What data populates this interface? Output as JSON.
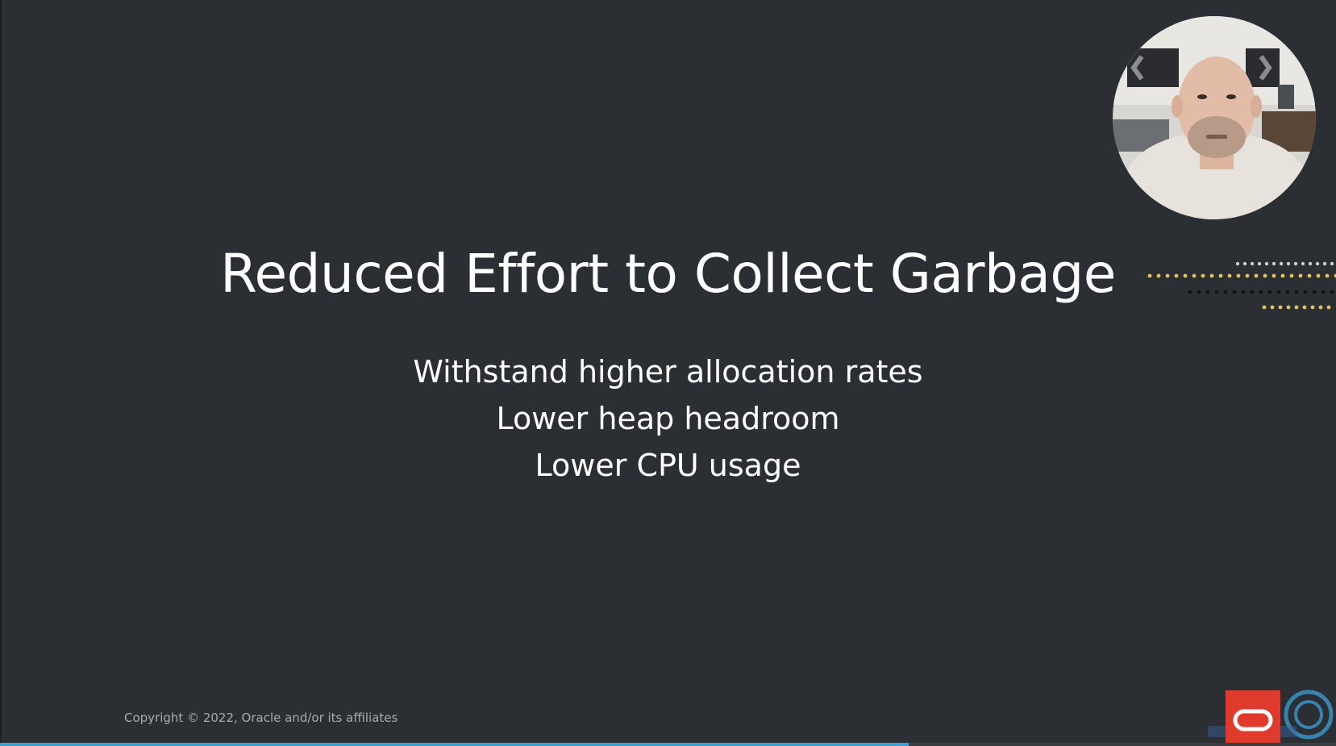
{
  "slide": {
    "title": "Reduced Effort to Collect Garbage",
    "bullets": [
      "Withstand higher allocation rates",
      "Lower heap headroom",
      "Lower CPU usage"
    ],
    "copyright": "Copyright © 2022, Oracle and/or its affiliates"
  },
  "colors": {
    "background": "#2b2e33",
    "text": "#ffffff",
    "copyright_text": "#a7aaaf",
    "oracle_red": "#e03a2c",
    "progress": "#3aa0d8",
    "dot_yellow": "#e6c15a",
    "dot_light": "#c9ced6",
    "dot_dark": "#111316"
  },
  "player": {
    "progress_fraction": 0.68
  },
  "icons": {
    "webcam": "presenter-webcam",
    "logo": "oracle-logo-icon",
    "watermark": "watermark-logo-icon"
  }
}
